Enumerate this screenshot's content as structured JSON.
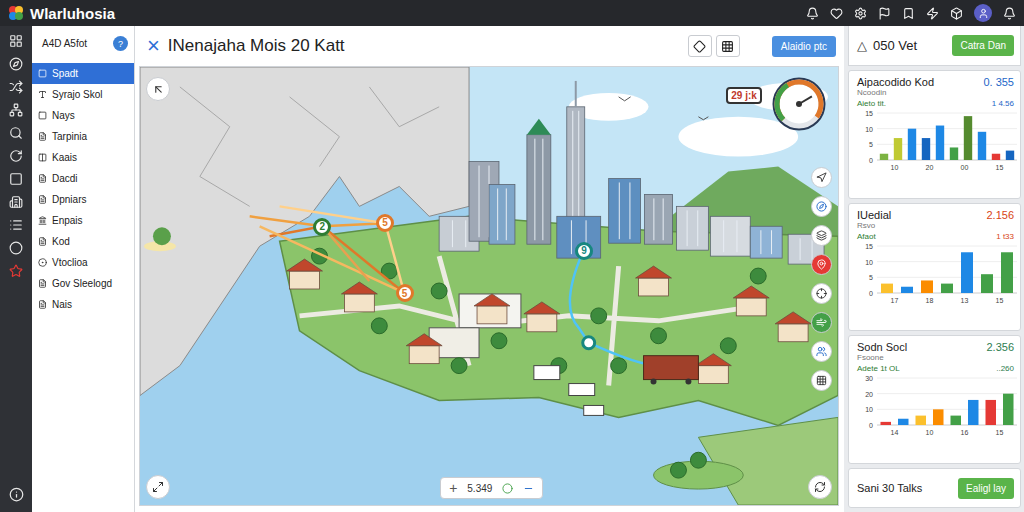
{
  "app": {
    "title": "Wlarluhosia"
  },
  "sidebar": {
    "title": "A4D A5fot",
    "badge": "?",
    "items": [
      {
        "label": "Spadt",
        "selected": true
      },
      {
        "label": "Syrajo Skol",
        "selected": false
      },
      {
        "label": "Nays",
        "selected": false
      },
      {
        "label": "Tarpinia",
        "selected": false
      },
      {
        "label": "Kaais",
        "selected": false
      },
      {
        "label": "Dacdi",
        "selected": false
      },
      {
        "label": "Dpniars",
        "selected": false
      },
      {
        "label": "Enpais",
        "selected": false
      },
      {
        "label": "Kod",
        "selected": false
      },
      {
        "label": "Vtoclioa",
        "selected": false
      },
      {
        "label": "Gov Sleelogd",
        "selected": false
      },
      {
        "label": "Nais",
        "selected": false
      }
    ]
  },
  "map": {
    "close": "×",
    "title": "INenajaha Mois 20 Katt",
    "action": "Alaidio ptc",
    "badge": "29 j:k",
    "gauge": {
      "level": 0.72
    },
    "pins": [
      {
        "label": "2",
        "color": "#2e7d32"
      },
      {
        "label": "5",
        "color": "#e0782a"
      },
      {
        "label": "5",
        "color": "#e0782a"
      },
      {
        "label": "9",
        "color": "#17877f"
      }
    ],
    "zoom": {
      "icon": "+",
      "value": "5.349"
    }
  },
  "panel": {
    "icon": "△",
    "title": "050 Vet",
    "button": "Catra Dan",
    "cards": [
      {
        "title": "Aipacodido Kod",
        "subtitle": "Ncoodin",
        "value": "0. 355",
        "color": "#1e66c8",
        "note": "Aieto tit.",
        "noteValue": "1 4.56",
        "ticks": [
          "15",
          "10",
          "5",
          "0"
        ],
        "labels": [
          "10",
          "20",
          "00",
          "15"
        ],
        "bars": [
          {
            "value": 2,
            "color": "#7cb342"
          },
          {
            "value": 7,
            "color": "#c0ca33"
          },
          {
            "value": 10,
            "color": "#1e88e5"
          },
          {
            "value": 7,
            "color": "#1565c0"
          },
          {
            "value": 11,
            "color": "#1e88e5"
          },
          {
            "value": 4,
            "color": "#43a047"
          },
          {
            "value": 14,
            "color": "#558b2f"
          },
          {
            "value": 9,
            "color": "#1e88e5"
          },
          {
            "value": 2,
            "color": "#e53935"
          },
          {
            "value": 3,
            "color": "#1565c0"
          }
        ]
      },
      {
        "title": "IUedial",
        "subtitle": "Rsvo",
        "value": "2.156",
        "color": "#d84315",
        "note": "Afaot",
        "noteValue": "1 t33",
        "ticks": [
          "15",
          "10",
          "5",
          "0"
        ],
        "labels": [
          "17",
          "18",
          "13",
          "15"
        ],
        "bars": [
          {
            "value": 3,
            "color": "#fbc02d"
          },
          {
            "value": 2,
            "color": "#1e88e5"
          },
          {
            "value": 4,
            "color": "#fb8c00"
          },
          {
            "value": 3,
            "color": "#43a047"
          },
          {
            "value": 13,
            "color": "#1e88e5"
          },
          {
            "value": 6,
            "color": "#43a047"
          },
          {
            "value": 13,
            "color": "#43a047"
          }
        ]
      },
      {
        "title": "Sodn Socl",
        "subtitle": "Fsoone",
        "value": "2.356",
        "color": "#2e7d4f",
        "note": "Adete 1t OL",
        "noteValue": "..260",
        "ticks": [
          "30",
          "20",
          "10",
          "0"
        ],
        "labels": [
          "14",
          "10",
          "16",
          "15"
        ],
        "bars": [
          {
            "value": 2,
            "color": "#e53935"
          },
          {
            "value": 4,
            "color": "#1e88e5"
          },
          {
            "value": 6,
            "color": "#fbc02d"
          },
          {
            "value": 10,
            "color": "#fb8c00"
          },
          {
            "value": 6,
            "color": "#43a047"
          },
          {
            "value": 16,
            "color": "#1e88e5"
          },
          {
            "value": 16,
            "color": "#e53935"
          },
          {
            "value": 20,
            "color": "#43a047"
          }
        ]
      }
    ],
    "footer": {
      "label": "Sani 30 Talks",
      "button": "Ealigl lay"
    }
  }
}
